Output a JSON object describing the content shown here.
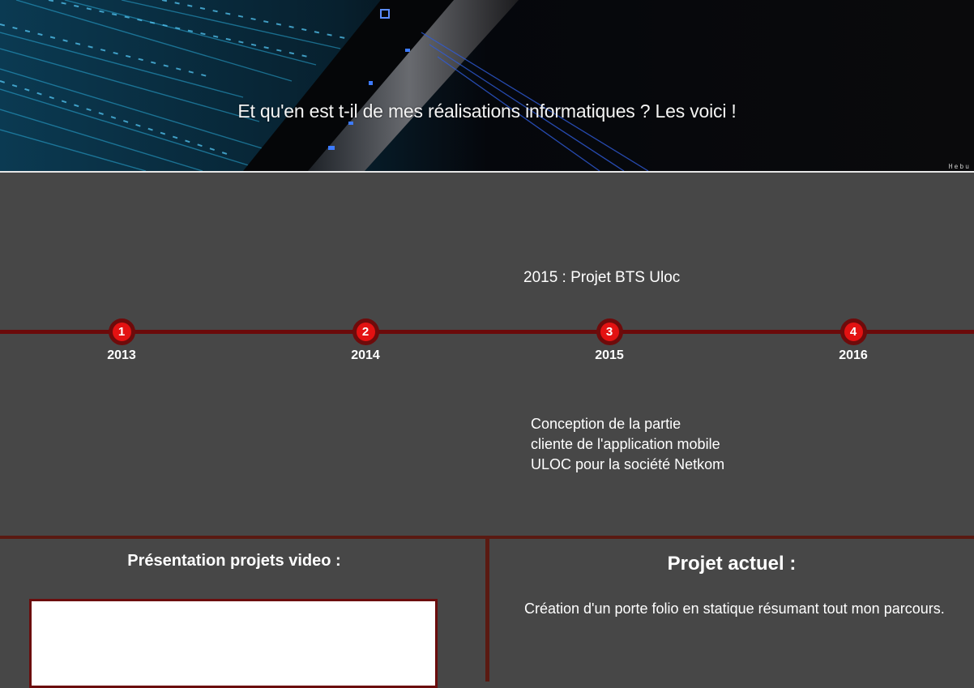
{
  "banner": {
    "title": "Et qu'en est t-il de mes réalisations informatiques ? Les voici !",
    "watermark": "Hebu"
  },
  "timeline": {
    "points": [
      {
        "number": "1",
        "year": "2013"
      },
      {
        "number": "2",
        "year": "2014"
      },
      {
        "number": "3",
        "year": "2015"
      },
      {
        "number": "4",
        "year": "2016"
      }
    ],
    "active_event": {
      "title": "2015 : Projet BTS Uloc",
      "description": "Conception de la partie cliente de l'application mobile ULOC pour la société Netkom"
    }
  },
  "video_section": {
    "heading": "Présentation projets video :"
  },
  "current_project": {
    "heading": "Projet actuel :",
    "description": "Création d'un porte folio en statique résumant tout mon parcours."
  },
  "colors": {
    "background": "#474747",
    "timeline_line": "#6b0a0a",
    "marker_fill": "#e31212",
    "marker_ring": "#6e0b0b",
    "divider": "#5a1a12"
  }
}
